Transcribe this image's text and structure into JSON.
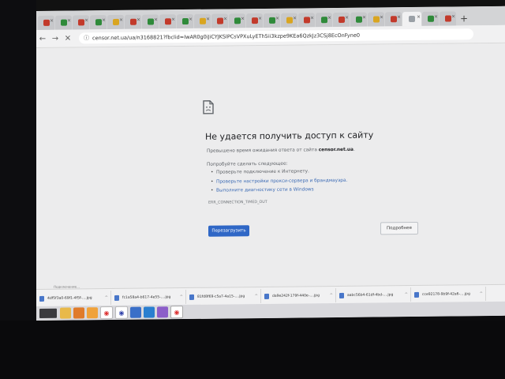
{
  "browser": {
    "address": "censor.net.ua/ua/n3168821?fbclid=IwAR0g0iJiCYJKSlPCsVPXuLyETh5ii3kzpe9KEa6QzkJz3CSj8EcOnFyne0",
    "tab_close_glyph": "×",
    "new_tab_glyph": "+"
  },
  "error_page": {
    "title": "Не удается получить доступ к сайту",
    "timeout_prefix": "Превышено время ожидания ответа от сайта",
    "site": "censor.net.ua",
    "try_label": "Попробуйте сделать следующее:",
    "suggestions": [
      "Проверьте подключение к Интернету.",
      "Проверьте настройки прокси-сервера и брандмауэра.",
      "Выполните диагностику сети в Windows"
    ],
    "error_code": "ERR_CONNECTION_TIMED_OUT",
    "reload_button": "Перезагрузить",
    "details_button": "Подробнее"
  },
  "downloads": {
    "status": "Подключение...",
    "items": [
      "4df5f3a0-69f1-4f5f-....jpg",
      "fc1a58a4-b617-4e55-....jpg",
      "81fd8f69-c5a7-4a15-....jpg",
      "da9e242f-179f-440e-....jpg",
      "aabc56b4-61df-4bd-....jpg",
      "cce92178-9b9f-42a6-....jpg"
    ]
  },
  "colors": {
    "accent": "#2f67c6",
    "link": "#3c6bb5"
  }
}
